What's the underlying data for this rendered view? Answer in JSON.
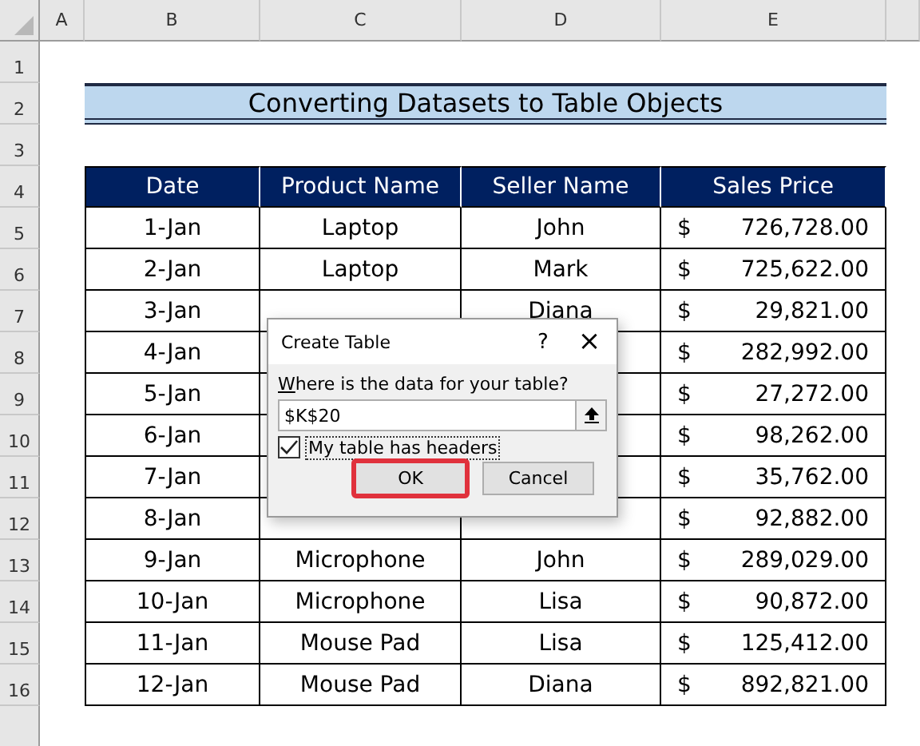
{
  "sheet": {
    "columns": [
      "A",
      "B",
      "C",
      "D",
      "E"
    ],
    "rows": [
      "1",
      "2",
      "3",
      "4",
      "5",
      "6",
      "7",
      "8",
      "9",
      "10",
      "11",
      "12",
      "13",
      "14",
      "15",
      "16"
    ]
  },
  "title": "Converting Datasets to Table Objects",
  "table": {
    "columns": [
      "Date",
      "Product Name",
      "Seller Name",
      "Sales Price"
    ],
    "rows": [
      {
        "date": "1-Jan",
        "product": "Laptop",
        "seller": "John",
        "currency": "$",
        "amount": "726,728.00"
      },
      {
        "date": "2-Jan",
        "product": "Laptop",
        "seller": "Mark",
        "currency": "$",
        "amount": "725,622.00"
      },
      {
        "date": "3-Jan",
        "seller": "Diana",
        "currency": "$",
        "amount": "29,821.00"
      },
      {
        "date": "4-Jan",
        "currency": "$",
        "amount": "282,992.00"
      },
      {
        "date": "5-Jan",
        "currency": "$",
        "amount": "27,272.00"
      },
      {
        "date": "6-Jan",
        "currency": "$",
        "amount": "98,262.00"
      },
      {
        "date": "7-Jan",
        "currency": "$",
        "amount": "35,762.00"
      },
      {
        "date": "8-Jan",
        "currency": "$",
        "amount": "92,882.00"
      },
      {
        "date": "9-Jan",
        "product": "Microphone",
        "seller": "John",
        "currency": "$",
        "amount": "289,029.00"
      },
      {
        "date": "10-Jan",
        "product": "Microphone",
        "seller": "Lisa",
        "currency": "$",
        "amount": "90,872.00"
      },
      {
        "date": "11-Jan",
        "product": "Mouse Pad",
        "seller": "Lisa",
        "currency": "$",
        "amount": "125,412.00"
      },
      {
        "date": "12-Jan",
        "product": "Mouse Pad",
        "seller": "Diana",
        "currency": "$",
        "amount": "892,821.00"
      }
    ]
  },
  "dialog": {
    "title": "Create Table",
    "help": "?",
    "close": "×",
    "prompt": "Where is the data for your table?",
    "range": "$K$20",
    "headers_label": "My table has headers",
    "headers_checked": true,
    "buttons": [
      {
        "label": "OK",
        "highlighted": true
      },
      {
        "label": "Cancel",
        "highlighted": false
      }
    ]
  }
}
